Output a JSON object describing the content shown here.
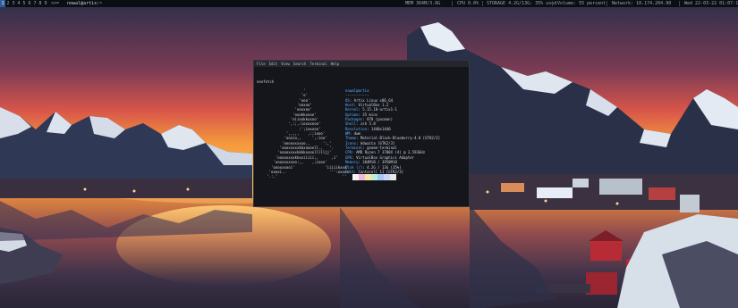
{
  "topbar": {
    "workspaces": [
      "1",
      "2",
      "3",
      "4",
      "5",
      "6",
      "7",
      "8",
      "9"
    ],
    "active_workspace": 0,
    "layout": "<>=",
    "window_title": "nowal@artix:~",
    "status": [
      "MEM 364M/3.8G",
      "CPU 0.0%",
      "STORAGE 4.2G/13G: 35% used",
      "Volume: 55 percent",
      "Network: 10.174.204.90",
      "Wed 22-03-22 01:07:11"
    ]
  },
  "terminal": {
    "menu": [
      "File",
      "Edit",
      "View",
      "Search",
      "Terminal",
      "Help"
    ],
    "command": "neofetch",
    "logo": "                    '\n                   'o'\n                  'ooo'\n                 'ooxoo'\n                'ooxxoo'\n               'oookkxxoo'\n              'oiioxkkxxoo'\n             ',:;,:ioxxxooo'\n                  :';ioxxoo'\n            ',,,,,    ,:;iooo'\n           'oooio,,     ',:ioo'\n          'ooooxxxxxo.,      ':,'\n         'oooxxxxxkkxooooll.,   '.\n        'ooooxxxxkkkkxxoollllljj'\n       'ooooxxxxkkxxiiiii;,      ,i'\n      'ooooxxxxxo:,,    ,;iooo'\n     'oooxxxooi'              'iiiiikxxo'\n    'oooxi..                    ''':oxxoo'\n   '.:.'                              '':ii'",
    "info": {
      "host": "nowal@artix",
      "rule": "-----------",
      "rows": [
        {
          "key": "OS",
          "value": "Artix Linux x86_64"
        },
        {
          "key": "Host",
          "value": "VirtualBox 1.2"
        },
        {
          "key": "Kernel",
          "value": "5.15.10-artix1-1"
        },
        {
          "key": "Uptime",
          "value": "35 mins"
        },
        {
          "key": "Packages",
          "value": "870 (pacman)"
        },
        {
          "key": "Shell",
          "value": "zsh 5.8"
        },
        {
          "key": "Resolution",
          "value": "1440x1440"
        },
        {
          "key": "WM",
          "value": "dwm"
        },
        {
          "key": "Theme",
          "value": "Material-Black-Blueberry-4.0 [GTK2/3]"
        },
        {
          "key": "Icons",
          "value": "Adwaita [GTK2/3]"
        },
        {
          "key": "Terminal",
          "value": "gnome-terminal"
        },
        {
          "key": "CPU",
          "value": "AMD Ryzen 7 3700X (4) @ 3.593GHz"
        },
        {
          "key": "GPU",
          "value": "VirtualBox Graphics Adapter"
        },
        {
          "key": "Memory",
          "value": "364MiB / 3950MiB"
        },
        {
          "key": "Disk (/)",
          "value": "4.2G / 13G (35%)"
        },
        {
          "key": "Font",
          "value": "Cantarell 11 [GTK2/3]"
        }
      ]
    },
    "palette": [
      "#14161c",
      "#f5f5f5",
      "#f0b9d8",
      "#f7e7a3",
      "#b8f0d8",
      "#a5c9f4",
      "#c8d6f8",
      "#e8e8e8"
    ]
  }
}
